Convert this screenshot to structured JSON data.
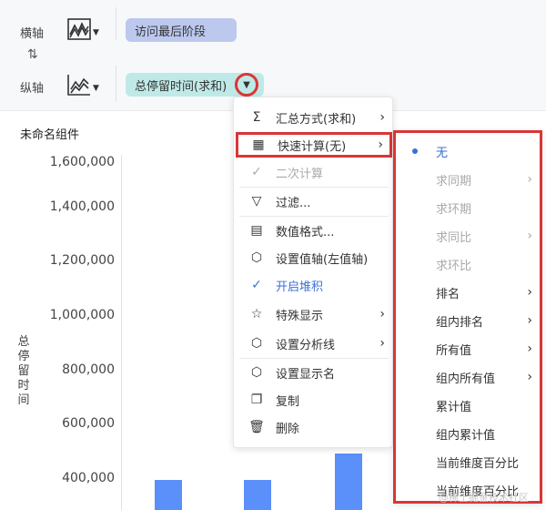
{
  "header": {
    "x_axis_label": "横轴",
    "y_axis_label": "纵轴",
    "x_chart_type_icon": "area-chart-type-icon",
    "y_chart_type_icon": "line-chart-type-icon",
    "swap_symbol": "⇅",
    "x_field": "访问最后阶段",
    "y_field": "总停留时间(求和)",
    "dropdown_caret": "▼"
  },
  "chart": {
    "widget_title": "未命名组件",
    "y_axis_title": "总停留时间",
    "y_ticks": [
      "1,600,000",
      "1,400,000",
      "1,200,000",
      "1,000,000",
      "800,000",
      "600,000",
      "400,000"
    ]
  },
  "chart_data": {
    "type": "bar",
    "title": "未命名组件",
    "ylabel": "总停留时间",
    "xlabel": "",
    "ylim": [
      300000,
      1700000
    ],
    "values": [
      400000,
      400000,
      500000
    ],
    "note_visible_region": "only bar tops visible; lower part cropped"
  },
  "context_menu": {
    "items": [
      {
        "icon": "Σ",
        "label": "汇总方式(求和)",
        "arrow": "›"
      },
      {
        "icon": "▦",
        "label": "快速计算(无)",
        "arrow": "›"
      },
      {
        "icon": "✓",
        "label": "二次计算"
      },
      {
        "icon": "▽",
        "label": "过滤..."
      },
      {
        "icon": "▤",
        "label": "数值格式..."
      },
      {
        "icon": "⬡",
        "label": "设置值轴(左值轴)"
      },
      {
        "icon": "✓",
        "label": "开启堆积"
      },
      {
        "icon": "☆",
        "label": "特殊显示",
        "arrow": "›"
      },
      {
        "icon": "⬡",
        "label": "设置分析线",
        "arrow": "›"
      },
      {
        "icon": "⬡",
        "label": "设置显示名"
      },
      {
        "icon": "❐",
        "label": "复制"
      },
      {
        "icon": "🗑",
        "label": "删除"
      }
    ]
  },
  "quick_calc_submenu": {
    "items": [
      {
        "label": "无"
      },
      {
        "label": "求同期",
        "arrow": "›"
      },
      {
        "label": "求环期"
      },
      {
        "label": "求同比",
        "arrow": "›"
      },
      {
        "label": "求环比"
      },
      {
        "label": "排名",
        "arrow": "›"
      },
      {
        "label": "组内排名",
        "arrow": "›"
      },
      {
        "label": "所有值",
        "arrow": "›"
      },
      {
        "label": "组内所有值",
        "arrow": "›"
      },
      {
        "label": "累计值"
      },
      {
        "label": "组内累计值"
      },
      {
        "label": "当前维度百分比"
      },
      {
        "label": "当前维度百分比"
      }
    ]
  },
  "watermark": "@稀土掘金技术社区",
  "colors": {
    "bar": "#5b8ff9",
    "x_pill": "#bcc8ee",
    "y_pill": "#bfe9e7",
    "highlight_red": "#d93636",
    "selected_blue": "#3b6fd8"
  }
}
